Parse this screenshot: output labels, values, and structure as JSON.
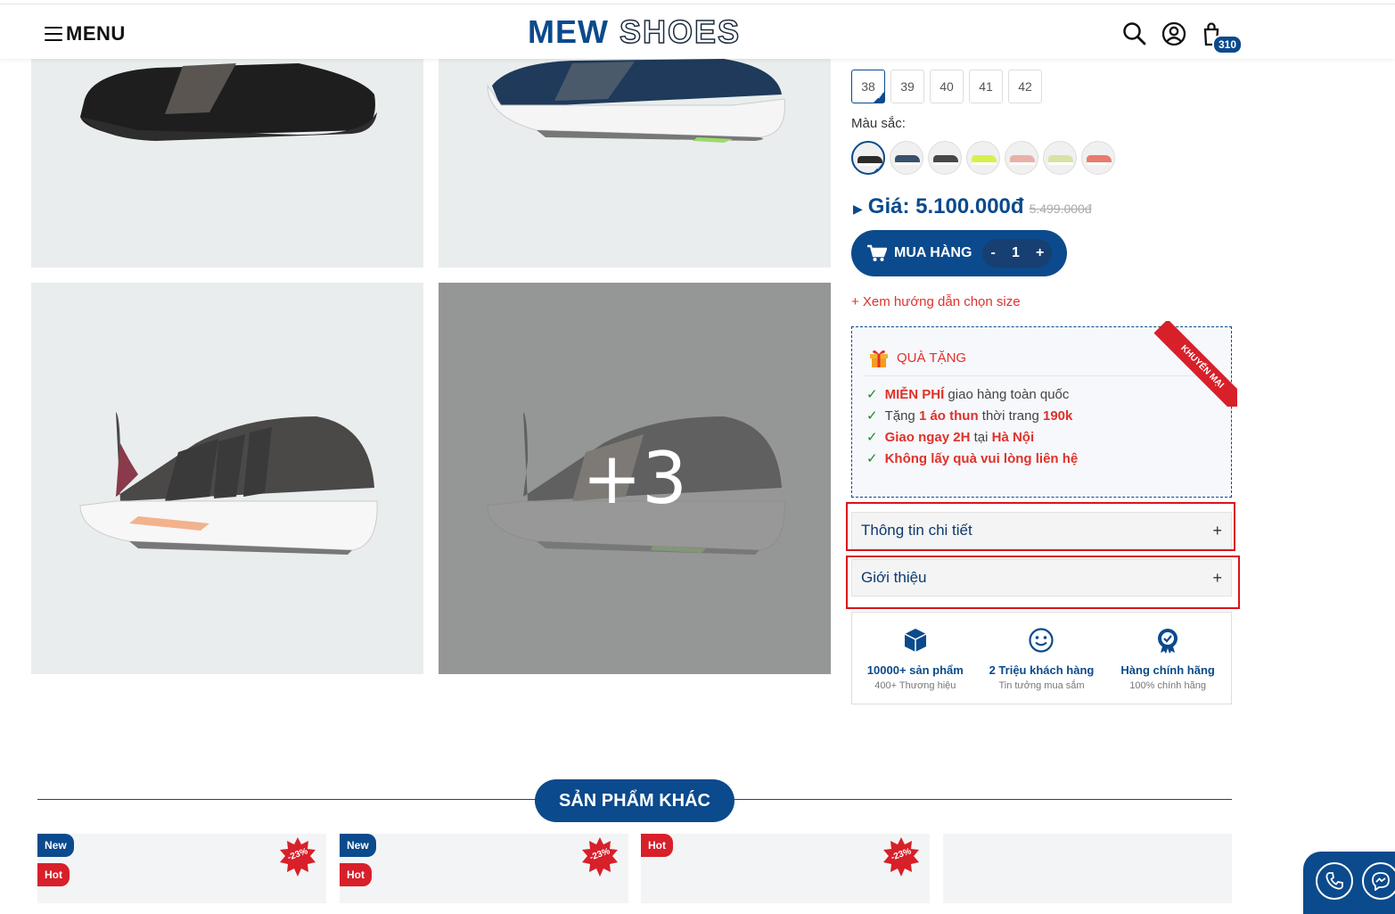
{
  "header": {
    "menu_label": "MENU",
    "logo_part1": "MEW",
    "logo_part2": "SHOES",
    "cart_count": "310"
  },
  "gallery": {
    "more_label": "+3"
  },
  "product": {
    "sizes": [
      "38",
      "39",
      "40",
      "41",
      "42"
    ],
    "selected_size": "38",
    "color_label": "Màu sắc:",
    "colors": [
      "#2b2b2b",
      "#3a4f6a",
      "#474747",
      "#d8f04a",
      "#e8b1a8",
      "#d8e2a4",
      "#e97a6d"
    ],
    "price_label": "Giá: 5.100.000đ",
    "price_old": "5.499.000đ",
    "buy_label": "MUA HÀNG",
    "qty_minus": "-",
    "qty_value": "1",
    "qty_plus": "+",
    "size_guide": "+ Xem hướng dẫn chọn size"
  },
  "gift": {
    "title": "QUÀ TẶNG",
    "ribbon": "KHUYẾN MẠI",
    "items": [
      {
        "check": "✓",
        "a_red": "MIỄN PHÍ",
        "b": " giao hàng toàn quốc",
        "c_red": "",
        "d": "",
        "e_red": ""
      },
      {
        "check": "✓",
        "a_red": "",
        "b": "Tặng ",
        "c_red": "1 áo thun",
        "d": " thời trang ",
        "e_red": "190k"
      },
      {
        "check": "✓",
        "a_red": "Giao ngay 2H",
        "b": " tại ",
        "c_red": "Hà Nội",
        "d": "",
        "e_red": ""
      },
      {
        "check": "✓",
        "a_red": "Không lấy quà vui lòng liên hệ",
        "b": "",
        "c_red": "",
        "d": "",
        "e_red": ""
      }
    ]
  },
  "accordion": {
    "details_label": "Thông tin chi tiết",
    "intro_label": "Giới thiệu",
    "plus": "+"
  },
  "features": [
    {
      "title": "10000+ sản phẩm",
      "sub": "400+ Thương hiệu"
    },
    {
      "title": "2 Triệu khách hàng",
      "sub": "Tin tưởng mua sắm"
    },
    {
      "title": "Hàng chính hãng",
      "sub": "100% chính hãng"
    }
  ],
  "related": {
    "title": "SẢN PHẨM KHÁC",
    "badge_new": "New",
    "badge_hot": "Hot",
    "discount": "-23%"
  },
  "colors": {
    "brand": "#0b4a8c",
    "accent_red": "#e0312b",
    "highlight_box": "#d9141b"
  }
}
